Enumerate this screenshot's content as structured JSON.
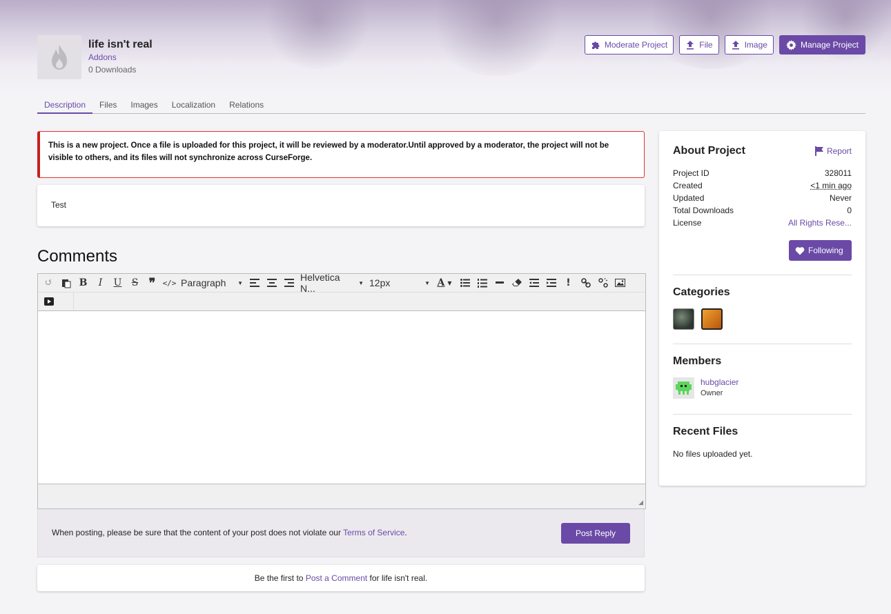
{
  "project": {
    "title": "life isn't real",
    "type": "Addons",
    "downloads": "0 Downloads"
  },
  "actions": {
    "moderate": "Moderate Project",
    "file": "File",
    "image": "Image",
    "manage": "Manage Project"
  },
  "tabs": [
    "Description",
    "Files",
    "Images",
    "Localization",
    "Relations"
  ],
  "alert": "This is a new project. Once a file is uploaded for this project, it will be reviewed by a moderator.Until approved by a moderator, the project will not be visible to others, and its files will not synchronize across CurseForge.",
  "description": "Test",
  "comments": {
    "title": "Comments",
    "editor": {
      "format_select": "Paragraph",
      "font_select": "Helvetica N...",
      "size_select": "12px"
    },
    "post_note_prefix": "When posting, please be sure that the content of your post does not violate our ",
    "tos_link": "Terms of Service",
    "post_note_suffix": ".",
    "post_button": "Post Reply",
    "first_prefix": "Be the first to ",
    "first_link": "Post a Comment",
    "first_suffix": " for life isn't real."
  },
  "sidebar": {
    "about_title": "About Project",
    "report": "Report",
    "info": [
      {
        "label": "Project ID",
        "value": "328011"
      },
      {
        "label": "Created",
        "value": "<1 min ago"
      },
      {
        "label": "Updated",
        "value": "Never"
      },
      {
        "label": "Total Downloads",
        "value": "0"
      },
      {
        "label": "License",
        "value": "All Rights Rese..."
      }
    ],
    "follow_button": "Following",
    "categories_title": "Categories",
    "members_title": "Members",
    "member_name": "hubglacier",
    "member_role": "Owner",
    "recent_files_title": "Recent Files",
    "no_files": "No files uploaded yet."
  },
  "colors": {
    "accent": "#6a4aa6",
    "alert_border": "#c81f1f"
  }
}
